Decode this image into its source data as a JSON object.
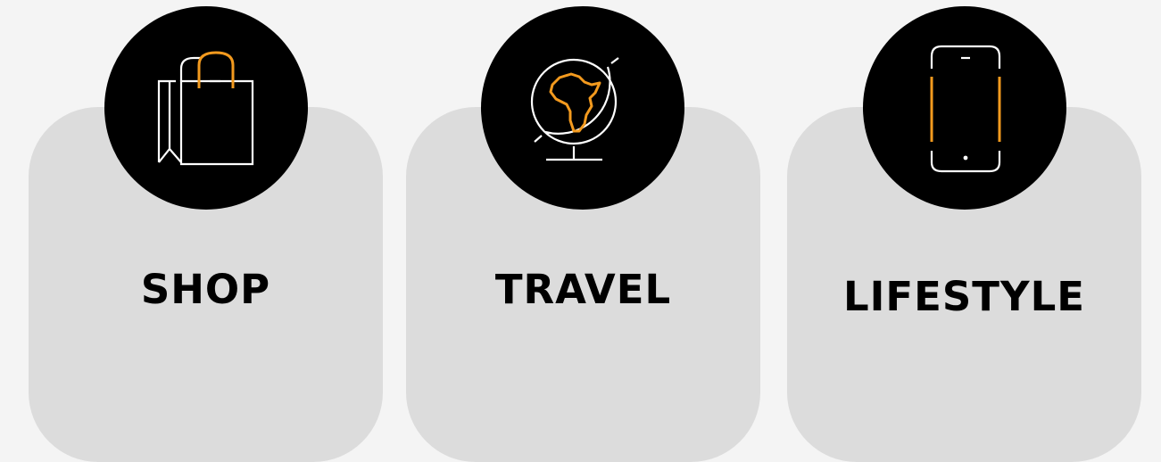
{
  "categories": [
    {
      "label": "SHOP",
      "icon": "shopping-bag-icon"
    },
    {
      "label": "TRAVEL",
      "icon": "globe-africa-icon"
    },
    {
      "label": "LIFESTYLE",
      "icon": "smartphone-icon"
    }
  ],
  "colors": {
    "background": "#f4f4f4",
    "card": "#dcdcdc",
    "badge": "#000000",
    "accent": "#f39a1e",
    "icon_line": "#ffffff",
    "text": "#000000"
  }
}
